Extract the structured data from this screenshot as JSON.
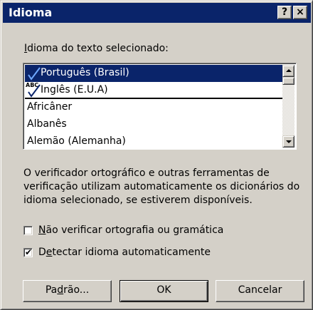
{
  "window": {
    "title": "Idioma",
    "help_label": "?",
    "close_label": "×"
  },
  "language_label": {
    "pre": "",
    "accel": "I",
    "post": "dioma do texto selecionado:"
  },
  "languages": [
    {
      "label": "Português (Brasil)",
      "selected": true,
      "spellcheck_icon": true
    },
    {
      "label": "Inglês (E.U.A)",
      "selected": false,
      "spellcheck_icon": true,
      "abc": "ABC"
    },
    {
      "label": "Africâner",
      "selected": false
    },
    {
      "label": "Albanês",
      "selected": false
    },
    {
      "label": "Alemão (Alemanha)",
      "selected": false
    }
  ],
  "description": "O verificador ortográfico e outras ferramentas de verificação utilizam automaticamente os dicionários do idioma selecionado, se estiverem disponíveis.",
  "checkboxes": {
    "no_check": {
      "pre": "",
      "accel": "N",
      "post": "ão verificar ortografia ou gramática",
      "checked": false
    },
    "detect": {
      "pre": "D",
      "accel": "e",
      "post": "tectar idioma automaticamente",
      "checked": true,
      "mark": "✔"
    }
  },
  "buttons": {
    "default": {
      "pre": "Pa",
      "accel": "d",
      "post": "rão..."
    },
    "ok": "OK",
    "cancel": "Cancelar"
  },
  "colors": {
    "face": "#d4d0c8",
    "titlebar": "#0a246a",
    "selection": "#0a246a"
  }
}
